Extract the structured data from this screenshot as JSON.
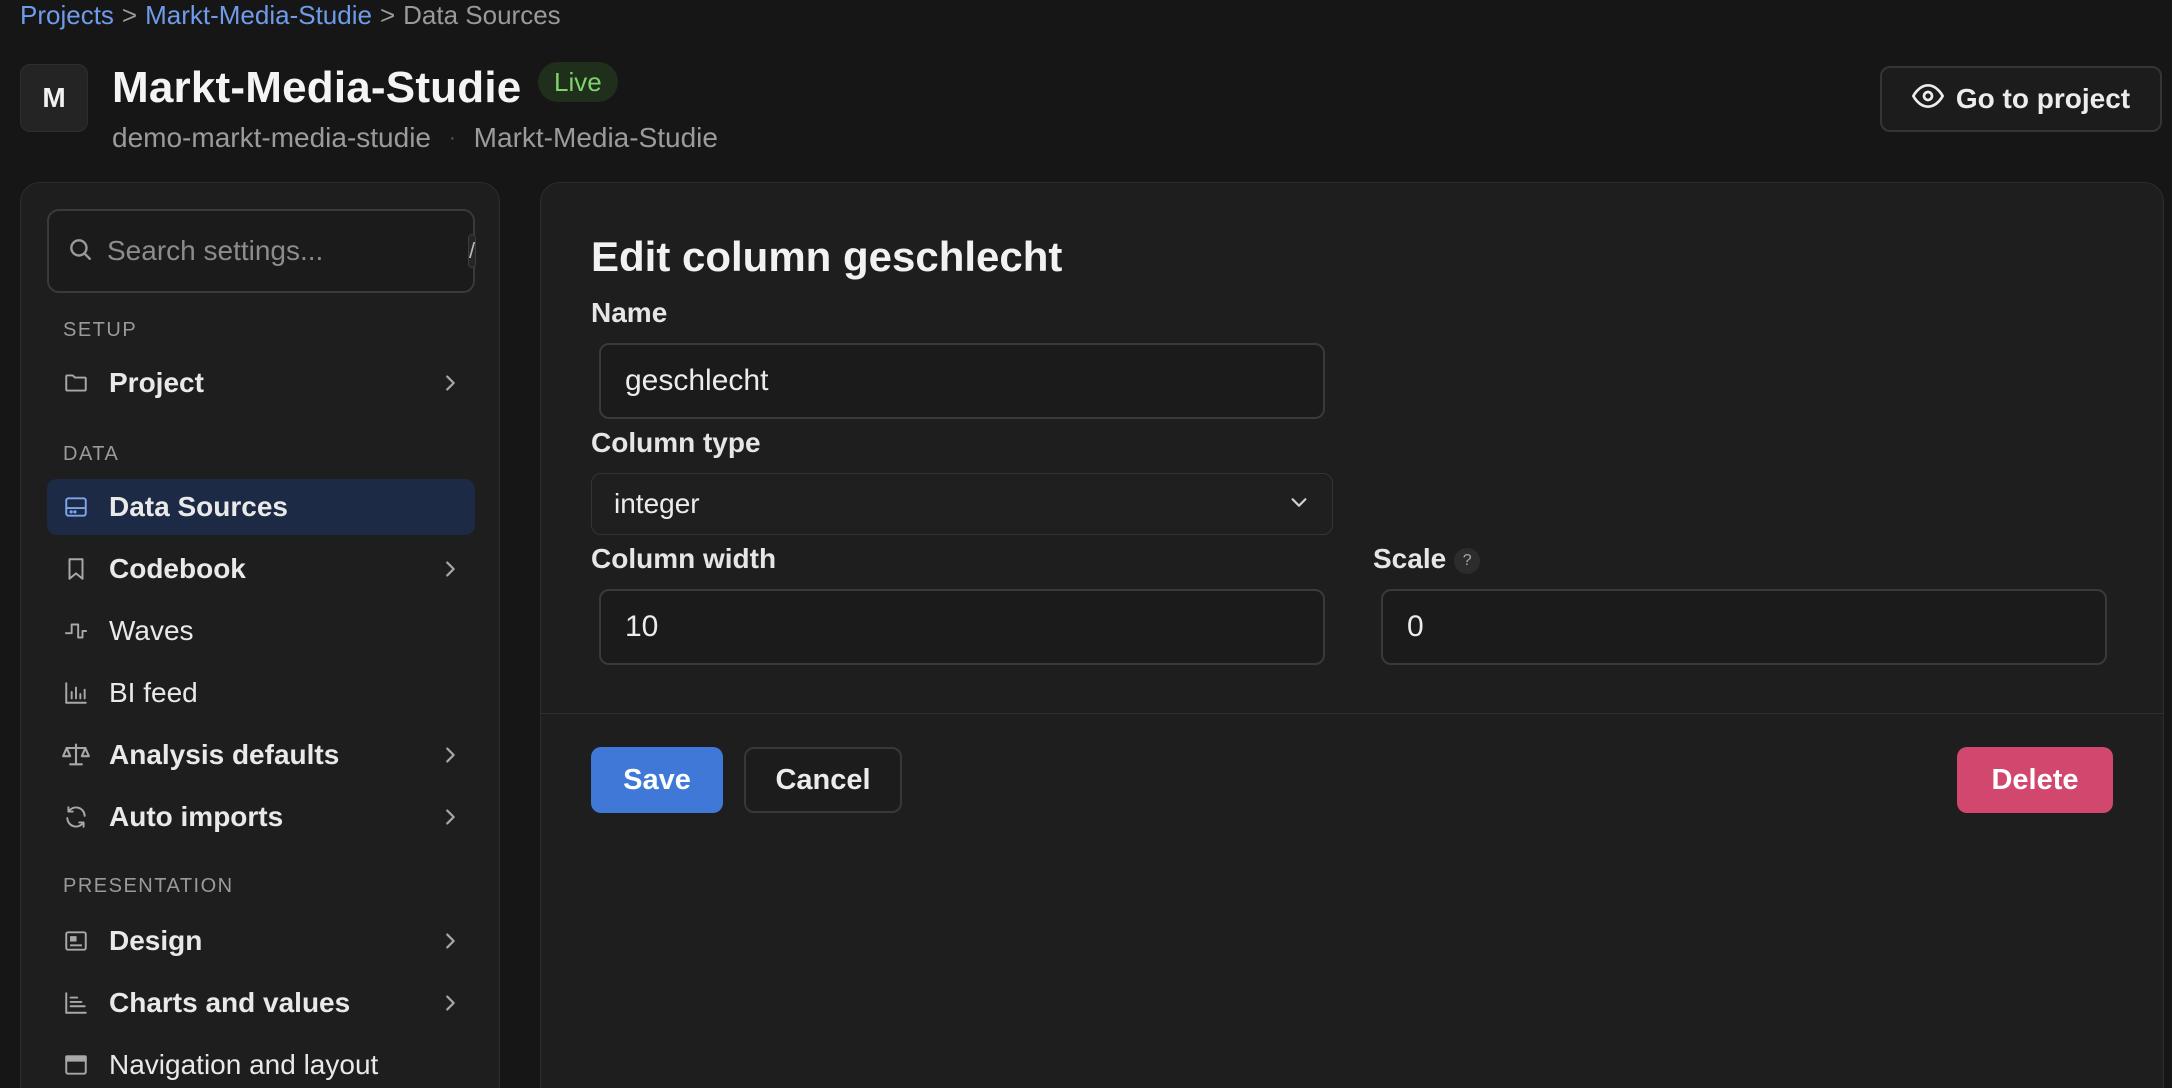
{
  "breadcrumb": {
    "items": [
      "Projects",
      ">",
      "Markt-Media-Studie",
      ">",
      "Data Sources"
    ]
  },
  "header": {
    "avatar_letter": "M",
    "title": "Markt-Media-Studie",
    "badge": "Live",
    "slug": "demo-markt-media-studie",
    "separator": "·",
    "subtitle_name": "Markt-Media-Studie",
    "go_to_project_label": "Go to project",
    "go_to_project_icon": "eye-icon"
  },
  "sidebar": {
    "search": {
      "placeholder": "Search settings...",
      "shortcut": "/"
    },
    "sections": {
      "setup": "SETUP",
      "data": "DATA",
      "presentation": "PRESENTATION"
    },
    "items": [
      {
        "label": "Project",
        "icon": "folder-icon",
        "has_children": true
      },
      {
        "label": "Data Sources",
        "icon": "database-icon",
        "active": true
      },
      {
        "label": "Codebook",
        "icon": "bookmark-icon",
        "has_children": true
      },
      {
        "label": "Waves",
        "icon": "waves-icon"
      },
      {
        "label": "BI feed",
        "icon": "bar-chart-icon"
      },
      {
        "label": "Analysis defaults",
        "icon": "scale-icon",
        "has_children": true
      },
      {
        "label": "Auto imports",
        "icon": "refresh-icon",
        "has_children": true
      },
      {
        "label": "Design",
        "icon": "image-icon",
        "has_children": true
      },
      {
        "label": "Charts and values",
        "icon": "chart-lines-icon",
        "has_children": true
      },
      {
        "label": "Navigation and layout",
        "icon": "layout-icon"
      }
    ]
  },
  "form": {
    "title": "Edit column geschlecht",
    "name_label": "Name",
    "name_value": "geschlecht",
    "type_label": "Column type",
    "type_value": "integer",
    "width_label": "Column width",
    "width_value": "10",
    "scale_label": "Scale",
    "scale_help": "?",
    "scale_value": "0",
    "save_label": "Save",
    "cancel_label": "Cancel",
    "delete_label": "Delete"
  },
  "colors": {
    "accent": "#3f78d6",
    "danger": "#d2476d",
    "live": "#7ed36b",
    "link": "#6f9bea"
  }
}
